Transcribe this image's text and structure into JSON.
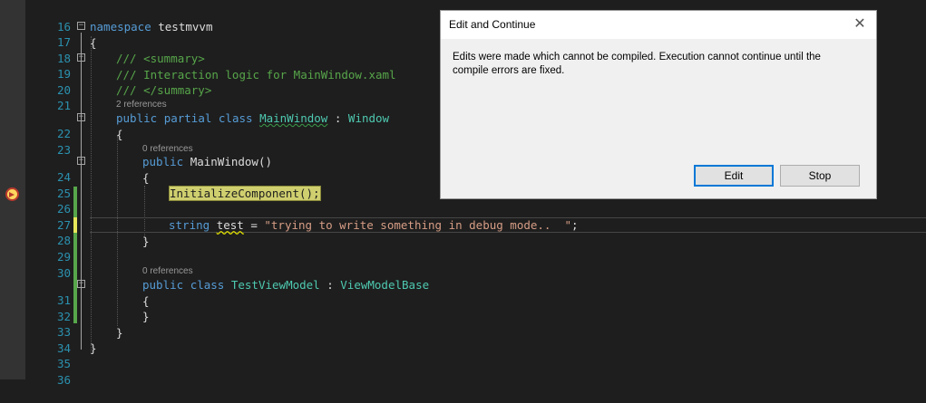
{
  "editor": {
    "lines": [
      {
        "num": "16"
      },
      {
        "num": "17"
      },
      {
        "num": "18"
      },
      {
        "num": "19"
      },
      {
        "num": "20"
      },
      {
        "num": "21"
      },
      {
        "num": "22"
      },
      {
        "num": "23"
      },
      {
        "num": "24"
      },
      {
        "num": "25"
      },
      {
        "num": "26"
      },
      {
        "num": "27"
      },
      {
        "num": "28"
      },
      {
        "num": "29"
      },
      {
        "num": "30"
      },
      {
        "num": "31"
      },
      {
        "num": "32"
      },
      {
        "num": "33"
      },
      {
        "num": "34"
      },
      {
        "num": "35"
      },
      {
        "num": "36"
      }
    ],
    "code": {
      "ns_kw": "namespace",
      "ns_name": " testmvvm",
      "brace_open": "{",
      "brace_close": "}",
      "summary_open": "/// <summary>",
      "summary_text": "/// Interaction logic for MainWindow.xaml",
      "summary_close": "/// </summary>",
      "public": "public",
      "partial": "partial",
      "class": "class",
      "mainwindow_type": "MainWindow",
      "colon": " : ",
      "window_type": "Window",
      "ctor_name": "MainWindow()",
      "init_call": "InitializeComponent();",
      "string_kw": "string",
      "test_var": "test",
      "equals": " = ",
      "string_literal": "\"trying to write something in debug mode..  \"",
      "semicolon": ";",
      "testvm_type": "TestViewModel",
      "vmbase_type": "ViewModelBase"
    },
    "codelens": {
      "refs_2": "2 references",
      "refs_0a": "0 references",
      "refs_0b": "0 references"
    }
  },
  "dialog": {
    "title": "Edit and Continue",
    "message": "Edits were made which cannot be compiled. Execution cannot continue until the compile errors are fixed.",
    "edit_label": "Edit",
    "stop_label": "Stop",
    "close_glyph": "✕"
  },
  "icons": {
    "breakpoint": "current-statement-breakpoint-icon",
    "close": "close-icon"
  },
  "colors": {
    "keyword": "#569cd6",
    "comment": "#57a64a",
    "string": "#d69d85",
    "type": "#4ec9b0",
    "line_number": "#2b91af"
  }
}
